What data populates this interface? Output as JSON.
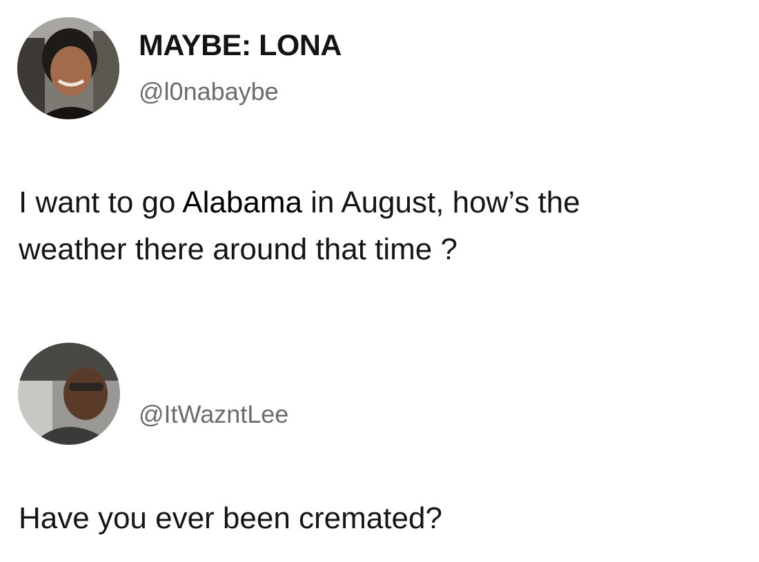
{
  "post": {
    "author": {
      "display_name": "MAYBE: LONA",
      "handle": "@l0nabaybe",
      "avatar_icon": "profile-photo-avatar"
    },
    "text_parts": {
      "line1_before": "I want to go ",
      "line1_highlight": "Alabama",
      "line1_after": " in August, how’s the",
      "line2": "weather there around that time ?"
    }
  },
  "reply": {
    "author": {
      "handle": "@ItWazntLee",
      "avatar_icon": "profile-photo-avatar"
    },
    "text": "Have you ever been cremated?"
  }
}
